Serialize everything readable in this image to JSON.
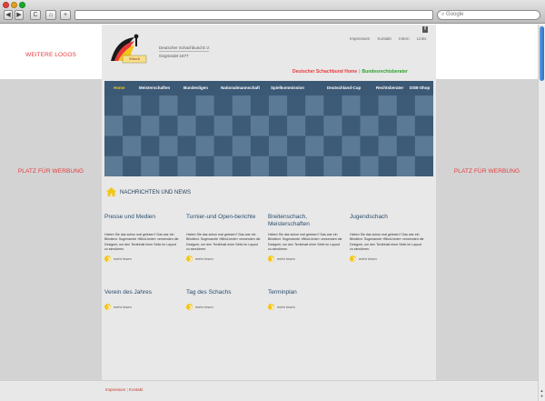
{
  "browser": {
    "search_placeholder": "Google",
    "nav": {
      "back": "◀",
      "forward": "▶",
      "reload": "C",
      "home": "⌂",
      "add": "+"
    }
  },
  "side": {
    "top_left": "WEITERE LOGOS",
    "ad_left": "PLATZ FÜR WERBUNG",
    "ad_right": "PLATZ FÜR WERBUNG"
  },
  "header": {
    "club_name": "Deutscher Schachbund E.V.",
    "club_year": "Gegründet 1877",
    "social_icon": "facebook-icon",
    "toplinks": [
      "Impressum",
      "Kontakt",
      "Intern",
      "Links"
    ],
    "brand_a": "Deutscher Schachbund Home",
    "brand_sep": "|",
    "brand_b": "Bundesrechtsberater"
  },
  "nav": {
    "items": [
      "Home",
      "Meisterschaften",
      "Bundesligen",
      "Nationalmannschaft",
      "Spielkommission",
      "Deutschland-Cup",
      "Rechtsberater",
      "DSB-Shop"
    ]
  },
  "news": {
    "title": "NACHRICHTEN UND NEWS",
    "icon": "home-icon",
    "more_label": "mehr lesen",
    "items": [
      {
        "title": "Presse und Medien",
        "text": "Haben Sie das schon mal gelesen? Das war ein Blindtext. Sogenannte »Blind-texte« verwenden die Designer, um den Textinhalt einer Seite im Layout zu simulieren."
      },
      {
        "title": "Turnier-und Open-berichte",
        "text": "Haben Sie das schon mal gelesen? Das war ein Blindtext. Sogenannte »Blind-texte« verwenden die Designer, um den Textinhalt einer Seite im Layout zu simulieren."
      },
      {
        "title": "Breitenschach, Meisterschaften",
        "text": "Haben Sie das schon mal gelesen? Das war ein Blindtext. Sogenannte »Blind-texte« verwenden die Designer, um den Textinhalt einer Seite im Layout zu simulieren."
      },
      {
        "title": "Jugendschach",
        "text": "Haben Sie das schon mal gelesen? Das war ein Blindtext. Sogenannte »Blind-texte« verwenden die Designer, um den Textinhalt einer Seite im Layout zu simulieren."
      },
      {
        "title": "Verein des Jahres",
        "text": ""
      },
      {
        "title": "Tag des Schachs",
        "text": ""
      },
      {
        "title": "Terminplan",
        "text": ""
      }
    ]
  },
  "footer": {
    "impressum": "Impressum",
    "sep": "|",
    "kontakt": "Kontakt"
  },
  "colors": {
    "accent_red": "#e8393b",
    "accent_green": "#2ca02c",
    "nav_bg": "#3b5875",
    "board_dark": "#3d5a77",
    "board_light": "#5b7a95",
    "home_yellow": "#f5c518"
  }
}
